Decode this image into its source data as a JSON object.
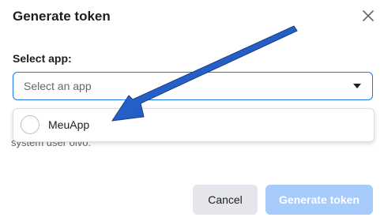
{
  "dialog": {
    "title": "Generate token",
    "close_icon": "close-icon"
  },
  "form": {
    "app_label": "Select app:",
    "app_select": {
      "placeholder": "Select an app",
      "caret_icon": "caret-down-icon"
    },
    "helper_text": "system user olvo."
  },
  "dropdown": {
    "options": [
      {
        "label": "MeuApp"
      }
    ]
  },
  "buttons": {
    "cancel": "Cancel",
    "generate": "Generate token"
  },
  "annotation": {
    "arrow_color": "#1f5bbd"
  },
  "colors": {
    "accent": "#1877f2",
    "generate_disabled": "#a7cbfa",
    "cancel_bg": "#e4e6eb"
  }
}
